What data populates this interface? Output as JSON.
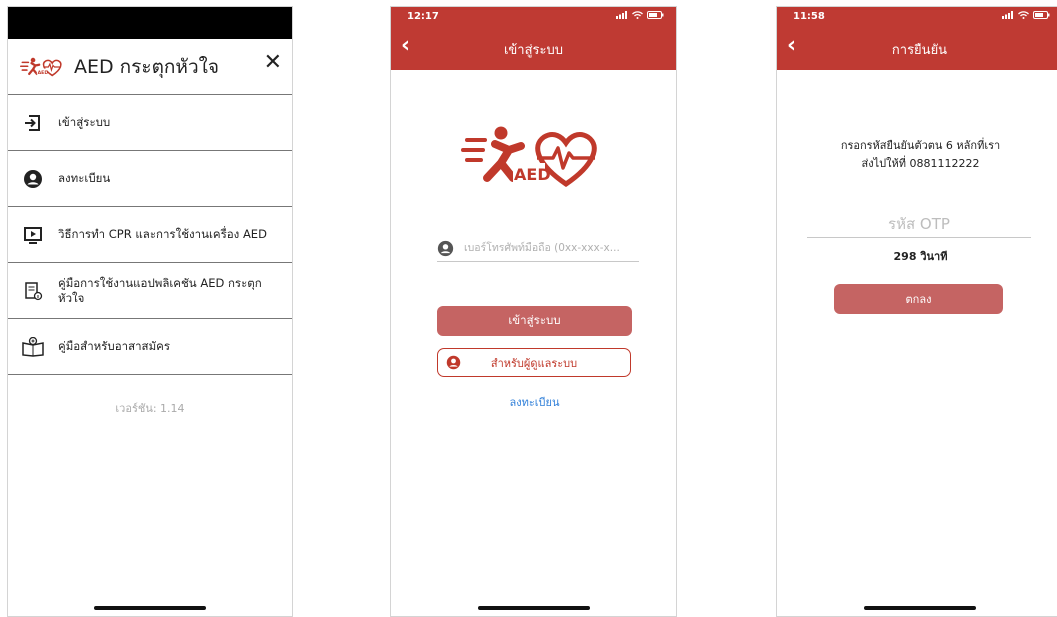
{
  "menu_screen": {
    "app_title": "AED กระตุกหัวใจ",
    "close_glyph": "✕",
    "items": [
      {
        "label": "เข้าสู่ระบบ",
        "icon": "login-icon"
      },
      {
        "label": "ลงทะเบียน",
        "icon": "user-circle-icon"
      },
      {
        "label": "วิธีการทำ CPR และการใช้งานเครื่อง AED",
        "icon": "video-play-icon"
      },
      {
        "label": "คู่มือการใช้งานแอปพลิเคชัน AED กระตุกหัวใจ",
        "icon": "manual-document-icon"
      },
      {
        "label": "คู่มือสำหรับอาสาสมัคร",
        "icon": "volunteer-book-icon"
      }
    ],
    "version": "เวอร์ชัน: 1.14"
  },
  "login_screen": {
    "status_time": "12:17",
    "title": "เข้าสู่ระบบ",
    "back_glyph": "‹",
    "phone_placeholder": "เบอร์โทรศัพท์มือถือ (0xx-xxx-x...",
    "login_button": "เข้าสู่ระบบ",
    "admin_button": "สำหรับผู้ดูแลระบบ",
    "register_link": "ลงทะเบียน"
  },
  "otp_screen": {
    "status_time": "11:58",
    "title": "การยืนยัน",
    "back_glyph": "‹",
    "message_line1": "กรอกรหัสยืนยันตัวตน 6 หลักที่เรา",
    "message_line2": "ส่งไปให้ที่ 0881112222",
    "otp_placeholder": "รหัส OTP",
    "countdown": "298 วินาที",
    "ok_button": "ตกลง"
  },
  "colors": {
    "brand_red": "#bf3a33",
    "button_red": "#c56463",
    "link_blue": "#2f7fd9"
  }
}
